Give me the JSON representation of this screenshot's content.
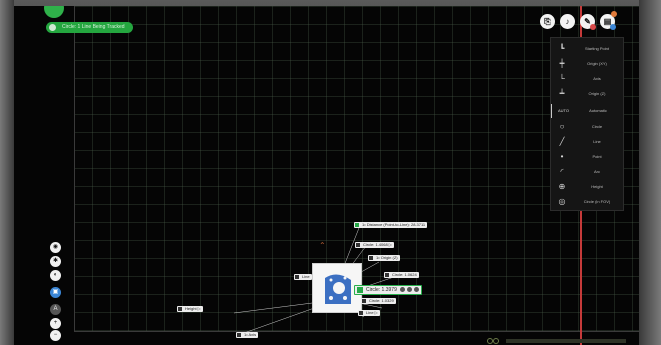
{
  "status_pill": {
    "text": "Circle: 1 Line Being Tracked"
  },
  "toolbar": {
    "buttons": [
      {
        "name": "export-icon",
        "glyph": "⎘"
      },
      {
        "name": "probe-icon",
        "glyph": "♪"
      },
      {
        "name": "measure-icon",
        "glyph": "✎"
      },
      {
        "name": "report-icon",
        "glyph": "▤"
      }
    ]
  },
  "feature_panel": {
    "items": [
      {
        "name": "starting-point",
        "icon": "┗",
        "label": "Starting Point"
      },
      {
        "name": "origin-xy",
        "icon": "┿",
        "label": "Origin (XY)"
      },
      {
        "name": "axis",
        "icon": "└",
        "label": "Axis"
      },
      {
        "name": "origin-z",
        "icon": "┷",
        "label": "Origin (Z)"
      },
      {
        "name": "automatic",
        "icon": "AUTO",
        "label": "Automatic"
      },
      {
        "name": "circle",
        "icon": "○",
        "label": "Circle"
      },
      {
        "name": "line",
        "icon": "╱",
        "label": "Line"
      },
      {
        "name": "point",
        "icon": "•",
        "label": "Point"
      },
      {
        "name": "arc",
        "icon": "◜",
        "label": "Arc"
      },
      {
        "name": "height",
        "icon": "⊕",
        "label": "Height"
      },
      {
        "name": "circle-in-fov",
        "icon": "◎",
        "label": "Circle (in FOV)"
      }
    ]
  },
  "left_toolbar": {
    "buttons": [
      {
        "name": "camera-icon",
        "glyph": "◉"
      },
      {
        "name": "light-icon",
        "glyph": "✱"
      },
      {
        "name": "focus-icon",
        "glyph": "◐"
      },
      {
        "name": "frame-icon",
        "glyph": "▣"
      },
      {
        "name": "auto-icon",
        "glyph": "A"
      },
      {
        "name": "zoom-in-icon",
        "glyph": "+"
      },
      {
        "name": "zoom-out-icon",
        "glyph": "−"
      }
    ]
  },
  "labels": {
    "distance": "1• Distance (Point-to-Line): 28.3711",
    "circle_a": "Circle: 1.4068 ▷",
    "origin_z": "1• Origin (Z)",
    "line_a": "Line",
    "circle_b": "Circle: 1.0624",
    "circle_sel": "Circle: 1.3979",
    "circle_c": "Circle: 1.0329",
    "line_b": "Line ▷",
    "height": "Height ▷",
    "axis": "1• Axis"
  },
  "colors": {
    "accent_green": "#2fb14a",
    "red_axis": "#c63a3a",
    "panel_bg": "#151515"
  }
}
